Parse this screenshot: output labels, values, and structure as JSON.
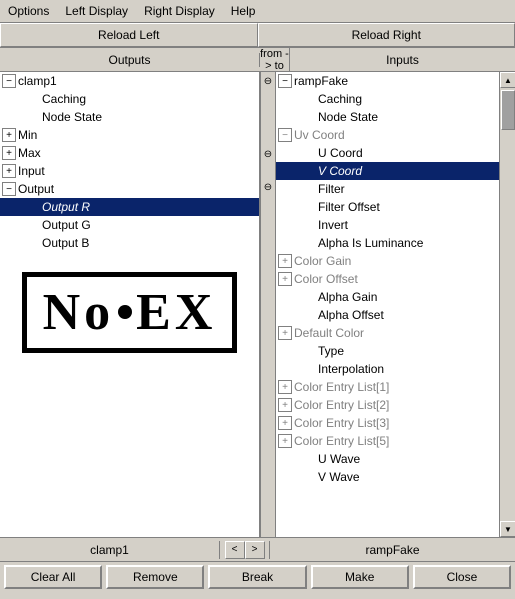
{
  "menubar": {
    "items": [
      "Options",
      "Left Display",
      "Right Display",
      "Help"
    ]
  },
  "toolbar": {
    "reload_left": "Reload Left",
    "reload_right": "Reload Right"
  },
  "col_headers": {
    "left": "Outputs",
    "mid": "from -> to",
    "right": "Inputs"
  },
  "left_panel": {
    "node_name": "clamp1",
    "items": [
      {
        "label": "clamp1",
        "indent": 0,
        "toggle": "minus",
        "style": "normal"
      },
      {
        "label": "Caching",
        "indent": 1,
        "toggle": "none",
        "style": "normal"
      },
      {
        "label": "Node State",
        "indent": 1,
        "toggle": "none",
        "style": "normal"
      },
      {
        "label": "Min",
        "indent": 0,
        "toggle": "plus",
        "style": "normal"
      },
      {
        "label": "Max",
        "indent": 0,
        "toggle": "plus",
        "style": "normal"
      },
      {
        "label": "Input",
        "indent": 0,
        "toggle": "plus",
        "style": "normal"
      },
      {
        "label": "Output",
        "indent": 0,
        "toggle": "minus",
        "style": "normal"
      },
      {
        "label": "Output R",
        "indent": 1,
        "toggle": "none",
        "style": "selected italic"
      },
      {
        "label": "Output G",
        "indent": 1,
        "toggle": "none",
        "style": "normal"
      },
      {
        "label": "Output B",
        "indent": 1,
        "toggle": "none",
        "style": "normal"
      }
    ]
  },
  "right_panel": {
    "node_name": "rampFake",
    "items": [
      {
        "label": "rampFake",
        "indent": 0,
        "toggle": "minus",
        "style": "normal"
      },
      {
        "label": "Caching",
        "indent": 1,
        "toggle": "none",
        "style": "normal"
      },
      {
        "label": "Node State",
        "indent": 1,
        "toggle": "none",
        "style": "normal"
      },
      {
        "label": "Uv Coord",
        "indent": 0,
        "toggle": "minus",
        "style": "grayed"
      },
      {
        "label": "U Coord",
        "indent": 1,
        "toggle": "none",
        "style": "normal"
      },
      {
        "label": "V Coord",
        "indent": 1,
        "toggle": "none",
        "style": "selected italic"
      },
      {
        "label": "Filter",
        "indent": 1,
        "toggle": "none",
        "style": "normal"
      },
      {
        "label": "Filter Offset",
        "indent": 1,
        "toggle": "none",
        "style": "normal"
      },
      {
        "label": "Invert",
        "indent": 1,
        "toggle": "none",
        "style": "normal"
      },
      {
        "label": "Alpha Is Luminance",
        "indent": 1,
        "toggle": "none",
        "style": "normal"
      },
      {
        "label": "Color Gain",
        "indent": 0,
        "toggle": "plus",
        "style": "grayed"
      },
      {
        "label": "Color Offset",
        "indent": 0,
        "toggle": "plus",
        "style": "grayed"
      },
      {
        "label": "Alpha Gain",
        "indent": 1,
        "toggle": "none",
        "style": "normal"
      },
      {
        "label": "Alpha Offset",
        "indent": 1,
        "toggle": "none",
        "style": "normal"
      },
      {
        "label": "Default Color",
        "indent": 0,
        "toggle": "plus",
        "style": "grayed"
      },
      {
        "label": "Type",
        "indent": 1,
        "toggle": "none",
        "style": "normal"
      },
      {
        "label": "Interpolation",
        "indent": 1,
        "toggle": "none",
        "style": "normal"
      },
      {
        "label": "Color Entry List[1]",
        "indent": 0,
        "toggle": "plus",
        "style": "grayed"
      },
      {
        "label": "Color Entry List[2]",
        "indent": 0,
        "toggle": "plus",
        "style": "grayed"
      },
      {
        "label": "Color Entry List[3]",
        "indent": 0,
        "toggle": "plus",
        "style": "grayed"
      },
      {
        "label": "Color Entry List[5]",
        "indent": 0,
        "toggle": "plus",
        "style": "grayed"
      },
      {
        "label": "U Wave",
        "indent": 1,
        "toggle": "none",
        "style": "normal"
      },
      {
        "label": "V Wave",
        "indent": 1,
        "toggle": "none",
        "style": "normal"
      }
    ]
  },
  "status_bar": {
    "left_node": "clamp1",
    "right_node": "rampFake",
    "nav_prev": "<",
    "nav_next": ">"
  },
  "action_bar": {
    "clear_all": "Clear All",
    "remove": "Remove",
    "break": "Break",
    "make": "Make",
    "close": "Close"
  },
  "logo": {
    "text_n": "N",
    "text_o": "o",
    "dot": "•",
    "text_ex": "EX"
  }
}
